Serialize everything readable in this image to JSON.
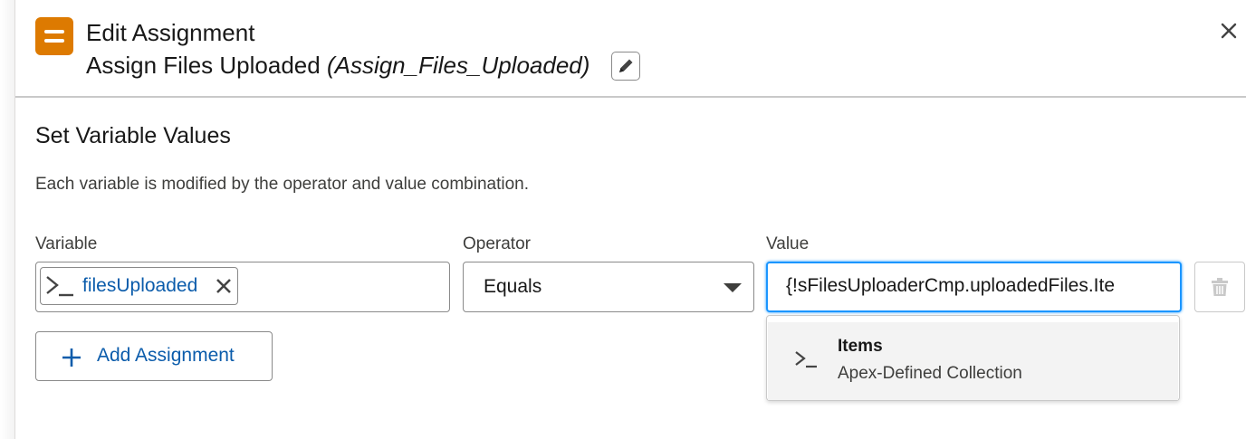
{
  "header": {
    "title": "Edit Assignment",
    "element_label": "Assign Files Uploaded",
    "element_api_name": "(Assign_Files_Uploaded)",
    "icon": "assignment-icon",
    "edit_icon": "pencil-icon",
    "close_icon": "close-icon"
  },
  "section": {
    "title": "Set Variable Values",
    "help_text": "Each variable is modified by the operator and value combination."
  },
  "columns": {
    "variable": "Variable",
    "operator": "Operator",
    "value": "Value"
  },
  "row": {
    "variable_pill": "filesUploaded",
    "variable_icon": "variable-icon",
    "operator_value": "Equals",
    "value_input": "{!sFilesUploaderCmp.uploadedFiles.Ite",
    "delete_icon": "trash-icon"
  },
  "add_button": {
    "label": "Add Assignment",
    "icon": "add-icon"
  },
  "dropdown": {
    "options": [
      {
        "title": "Items",
        "meta": "Apex-Defined Collection",
        "icon": "variable-icon"
      }
    ]
  },
  "colors": {
    "brand_orange": "#dd7a01",
    "link_blue": "#0b5cab",
    "focus_blue": "#1b96ff"
  }
}
